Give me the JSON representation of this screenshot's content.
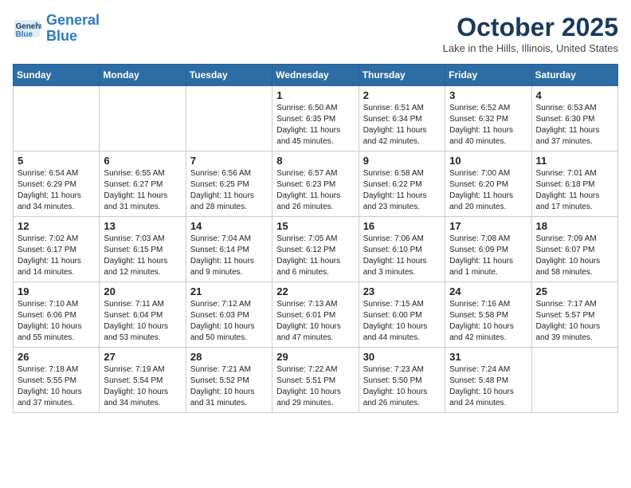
{
  "logo": {
    "line1": "General",
    "line2": "Blue"
  },
  "title": "October 2025",
  "location": "Lake in the Hills, Illinois, United States",
  "weekdays": [
    "Sunday",
    "Monday",
    "Tuesday",
    "Wednesday",
    "Thursday",
    "Friday",
    "Saturday"
  ],
  "weeks": [
    [
      {
        "day": "",
        "info": ""
      },
      {
        "day": "",
        "info": ""
      },
      {
        "day": "",
        "info": ""
      },
      {
        "day": "1",
        "info": "Sunrise: 6:50 AM\nSunset: 6:35 PM\nDaylight: 11 hours\nand 45 minutes."
      },
      {
        "day": "2",
        "info": "Sunrise: 6:51 AM\nSunset: 6:34 PM\nDaylight: 11 hours\nand 42 minutes."
      },
      {
        "day": "3",
        "info": "Sunrise: 6:52 AM\nSunset: 6:32 PM\nDaylight: 11 hours\nand 40 minutes."
      },
      {
        "day": "4",
        "info": "Sunrise: 6:53 AM\nSunset: 6:30 PM\nDaylight: 11 hours\nand 37 minutes."
      }
    ],
    [
      {
        "day": "5",
        "info": "Sunrise: 6:54 AM\nSunset: 6:29 PM\nDaylight: 11 hours\nand 34 minutes."
      },
      {
        "day": "6",
        "info": "Sunrise: 6:55 AM\nSunset: 6:27 PM\nDaylight: 11 hours\nand 31 minutes."
      },
      {
        "day": "7",
        "info": "Sunrise: 6:56 AM\nSunset: 6:25 PM\nDaylight: 11 hours\nand 28 minutes."
      },
      {
        "day": "8",
        "info": "Sunrise: 6:57 AM\nSunset: 6:23 PM\nDaylight: 11 hours\nand 26 minutes."
      },
      {
        "day": "9",
        "info": "Sunrise: 6:58 AM\nSunset: 6:22 PM\nDaylight: 11 hours\nand 23 minutes."
      },
      {
        "day": "10",
        "info": "Sunrise: 7:00 AM\nSunset: 6:20 PM\nDaylight: 11 hours\nand 20 minutes."
      },
      {
        "day": "11",
        "info": "Sunrise: 7:01 AM\nSunset: 6:18 PM\nDaylight: 11 hours\nand 17 minutes."
      }
    ],
    [
      {
        "day": "12",
        "info": "Sunrise: 7:02 AM\nSunset: 6:17 PM\nDaylight: 11 hours\nand 14 minutes."
      },
      {
        "day": "13",
        "info": "Sunrise: 7:03 AM\nSunset: 6:15 PM\nDaylight: 11 hours\nand 12 minutes."
      },
      {
        "day": "14",
        "info": "Sunrise: 7:04 AM\nSunset: 6:14 PM\nDaylight: 11 hours\nand 9 minutes."
      },
      {
        "day": "15",
        "info": "Sunrise: 7:05 AM\nSunset: 6:12 PM\nDaylight: 11 hours\nand 6 minutes."
      },
      {
        "day": "16",
        "info": "Sunrise: 7:06 AM\nSunset: 6:10 PM\nDaylight: 11 hours\nand 3 minutes."
      },
      {
        "day": "17",
        "info": "Sunrise: 7:08 AM\nSunset: 6:09 PM\nDaylight: 11 hours\nand 1 minute."
      },
      {
        "day": "18",
        "info": "Sunrise: 7:09 AM\nSunset: 6:07 PM\nDaylight: 10 hours\nand 58 minutes."
      }
    ],
    [
      {
        "day": "19",
        "info": "Sunrise: 7:10 AM\nSunset: 6:06 PM\nDaylight: 10 hours\nand 55 minutes."
      },
      {
        "day": "20",
        "info": "Sunrise: 7:11 AM\nSunset: 6:04 PM\nDaylight: 10 hours\nand 53 minutes."
      },
      {
        "day": "21",
        "info": "Sunrise: 7:12 AM\nSunset: 6:03 PM\nDaylight: 10 hours\nand 50 minutes."
      },
      {
        "day": "22",
        "info": "Sunrise: 7:13 AM\nSunset: 6:01 PM\nDaylight: 10 hours\nand 47 minutes."
      },
      {
        "day": "23",
        "info": "Sunrise: 7:15 AM\nSunset: 6:00 PM\nDaylight: 10 hours\nand 44 minutes."
      },
      {
        "day": "24",
        "info": "Sunrise: 7:16 AM\nSunset: 5:58 PM\nDaylight: 10 hours\nand 42 minutes."
      },
      {
        "day": "25",
        "info": "Sunrise: 7:17 AM\nSunset: 5:57 PM\nDaylight: 10 hours\nand 39 minutes."
      }
    ],
    [
      {
        "day": "26",
        "info": "Sunrise: 7:18 AM\nSunset: 5:55 PM\nDaylight: 10 hours\nand 37 minutes."
      },
      {
        "day": "27",
        "info": "Sunrise: 7:19 AM\nSunset: 5:54 PM\nDaylight: 10 hours\nand 34 minutes."
      },
      {
        "day": "28",
        "info": "Sunrise: 7:21 AM\nSunset: 5:52 PM\nDaylight: 10 hours\nand 31 minutes."
      },
      {
        "day": "29",
        "info": "Sunrise: 7:22 AM\nSunset: 5:51 PM\nDaylight: 10 hours\nand 29 minutes."
      },
      {
        "day": "30",
        "info": "Sunrise: 7:23 AM\nSunset: 5:50 PM\nDaylight: 10 hours\nand 26 minutes."
      },
      {
        "day": "31",
        "info": "Sunrise: 7:24 AM\nSunset: 5:48 PM\nDaylight: 10 hours\nand 24 minutes."
      },
      {
        "day": "",
        "info": ""
      }
    ]
  ]
}
